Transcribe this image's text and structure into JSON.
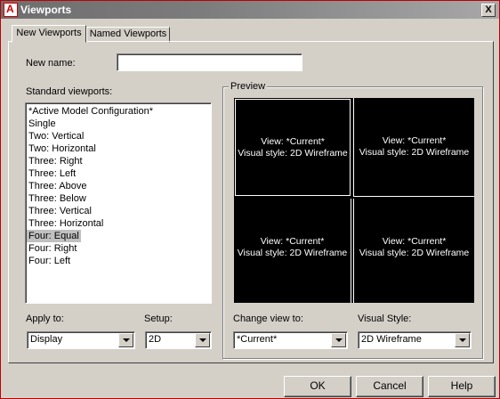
{
  "window": {
    "title": "Viewports",
    "close_label": "X"
  },
  "tabs": [
    {
      "label": "New Viewports",
      "active": true
    },
    {
      "label": "Named Viewports",
      "active": false
    }
  ],
  "new_name": {
    "label": "New name:",
    "value": ""
  },
  "standard_viewports": {
    "label": "Standard viewports:",
    "items": [
      "*Active Model Configuration*",
      "Single",
      "Two:  Vertical",
      "Two:  Horizontal",
      "Three: Right",
      "Three: Left",
      "Three: Above",
      "Three: Below",
      "Three: Vertical",
      "Three: Horizontal",
      "Four:  Equal",
      "Four:  Right",
      "Four:  Left"
    ],
    "selected": "Four:  Equal"
  },
  "preview": {
    "label": "Preview",
    "viewports": [
      {
        "view": "View: *Current*",
        "style": "Visual style: 2D Wireframe"
      },
      {
        "view": "View: *Current*",
        "style": "Visual style: 2D Wireframe"
      },
      {
        "view": "View: *Current*",
        "style": "Visual style: 2D Wireframe"
      },
      {
        "view": "View: *Current*",
        "style": "Visual style: 2D Wireframe"
      }
    ]
  },
  "apply_to": {
    "label": "Apply to:",
    "value": "Display"
  },
  "setup": {
    "label": "Setup:",
    "value": "2D"
  },
  "change_view_to": {
    "label": "Change view to:",
    "value": "*Current*"
  },
  "visual_style": {
    "label": "Visual Style:",
    "value": "2D Wireframe"
  },
  "buttons": {
    "ok": "OK",
    "cancel": "Cancel",
    "help": "Help"
  }
}
